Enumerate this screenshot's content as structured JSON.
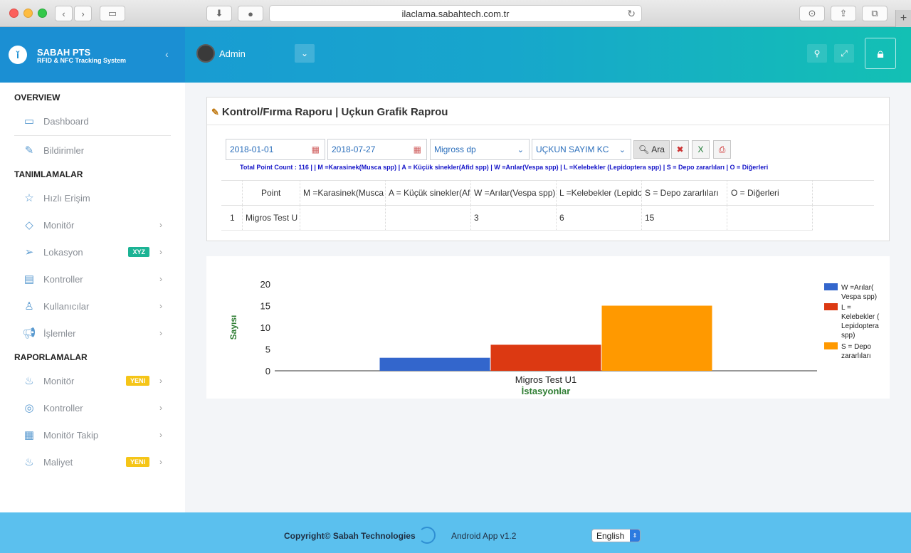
{
  "browser": {
    "url": "ilaclama.sabahtech.com.tr"
  },
  "brand": {
    "title": "SABAH PTS",
    "subtitle": "RFID & NFC Tracking System"
  },
  "topbar": {
    "user": "Admin"
  },
  "sidebar": {
    "sections": [
      {
        "label": "OVERVIEW"
      },
      {
        "label": "TANIMLAMALAR"
      },
      {
        "label": "RAPORLAMALAR"
      }
    ],
    "items": [
      {
        "label": "Dashboard"
      },
      {
        "label": "Bildirimler"
      },
      {
        "label": "Hızlı Erişim"
      },
      {
        "label": "Monitör"
      },
      {
        "label": "Lokasyon",
        "badge": "XYZ"
      },
      {
        "label": "Kontroller"
      },
      {
        "label": "Kullanıcılar"
      },
      {
        "label": "İşlemler"
      },
      {
        "label": "Monitör",
        "badge": "YENI"
      },
      {
        "label": "Kontroller"
      },
      {
        "label": "Monitör Takip"
      },
      {
        "label": "Maliyet",
        "badge": "YENI"
      }
    ]
  },
  "report": {
    "title": "Kontrol/Fırma Raporu | Uçkun Grafik Raprou",
    "filters": {
      "start_date": "2018-01-01",
      "end_date": "2018-07-27",
      "company": "Migross dp",
      "type": "UÇKUN SAYIM KC",
      "search_label": "Ara"
    },
    "summary": "Total Point Count : 116 | | M =Karasinek(Musca spp) | A = Küçük sinekler(Afid spp) | W =Arılar(Vespa spp) | L =Kelebekler (Lepidoptera spp) | S = Depo zararlıları | O = Diğerleri",
    "table": {
      "headers": [
        "",
        "Point",
        "M =Karasinek(Musca",
        "A = Küçük sinekler(Af",
        "W =Arılar(Vespa spp)",
        "L =Kelebekler (Lepidc",
        "S = Depo zararlıları",
        "O = Diğerleri",
        ""
      ],
      "rows": [
        [
          "1",
          "Migros Test U",
          "",
          "",
          "3",
          "6",
          "15",
          "",
          ""
        ]
      ]
    }
  },
  "chart_data": {
    "type": "bar",
    "categories": [
      "Migros Test U1"
    ],
    "series": [
      {
        "name": "W =Arılar( Vespa spp)",
        "values": [
          3
        ],
        "color": "#3366cc"
      },
      {
        "name": "L = Kelebekler ( Lepidoptera spp)",
        "values": [
          6
        ],
        "color": "#dc3912"
      },
      {
        "name": "S = Depo zararlıları",
        "values": [
          15
        ],
        "color": "#ff9900"
      }
    ],
    "xlabel": "İstasyonlar",
    "ylabel": "Sayısı",
    "ylim": [
      0,
      20
    ],
    "yticks": [
      0,
      5,
      10,
      15,
      20
    ],
    "legend": "right"
  },
  "footer": {
    "copyright": "Copyright© Sabah Technologies",
    "app": "Android App v1.2",
    "language": "English"
  }
}
